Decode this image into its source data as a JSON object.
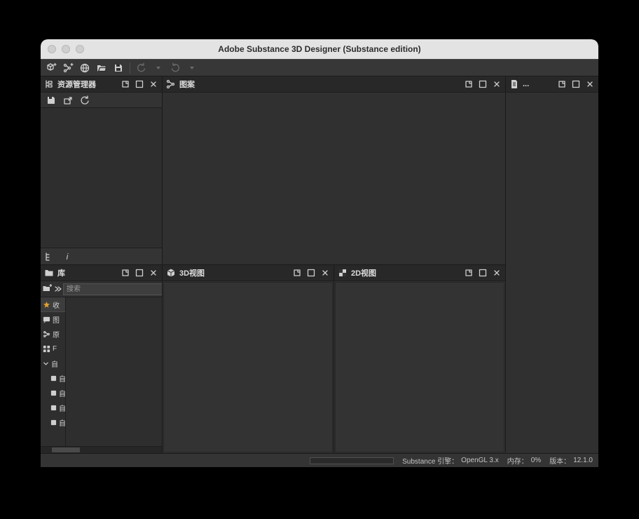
{
  "window": {
    "title": "Adobe Substance 3D Designer (Substance edition)"
  },
  "panels": {
    "explorer": {
      "title": "资源管理器"
    },
    "graph": {
      "title": "图案"
    },
    "props": {
      "title": "..."
    },
    "library": {
      "title": "库"
    },
    "view3d": {
      "title": "3D视图"
    },
    "view2d": {
      "title": "2D视图"
    }
  },
  "library": {
    "search_placeholder": "搜索",
    "items": [
      {
        "icon": "star",
        "label": "收"
      },
      {
        "icon": "chat",
        "label": "图"
      },
      {
        "icon": "nodes",
        "label": "原"
      },
      {
        "icon": "grid",
        "label": "F"
      },
      {
        "icon": "chevron",
        "label": "自"
      }
    ],
    "subitems": [
      {
        "label": "自"
      },
      {
        "label": "自"
      },
      {
        "label": "自"
      },
      {
        "label": "自"
      }
    ]
  },
  "status": {
    "engine_label": "Substance 引擎：",
    "engine_value": "OpenGL 3.x",
    "mem_label": "内存：",
    "mem_value": "0%",
    "version_label": "版本：",
    "version_value": "12.1.0"
  }
}
